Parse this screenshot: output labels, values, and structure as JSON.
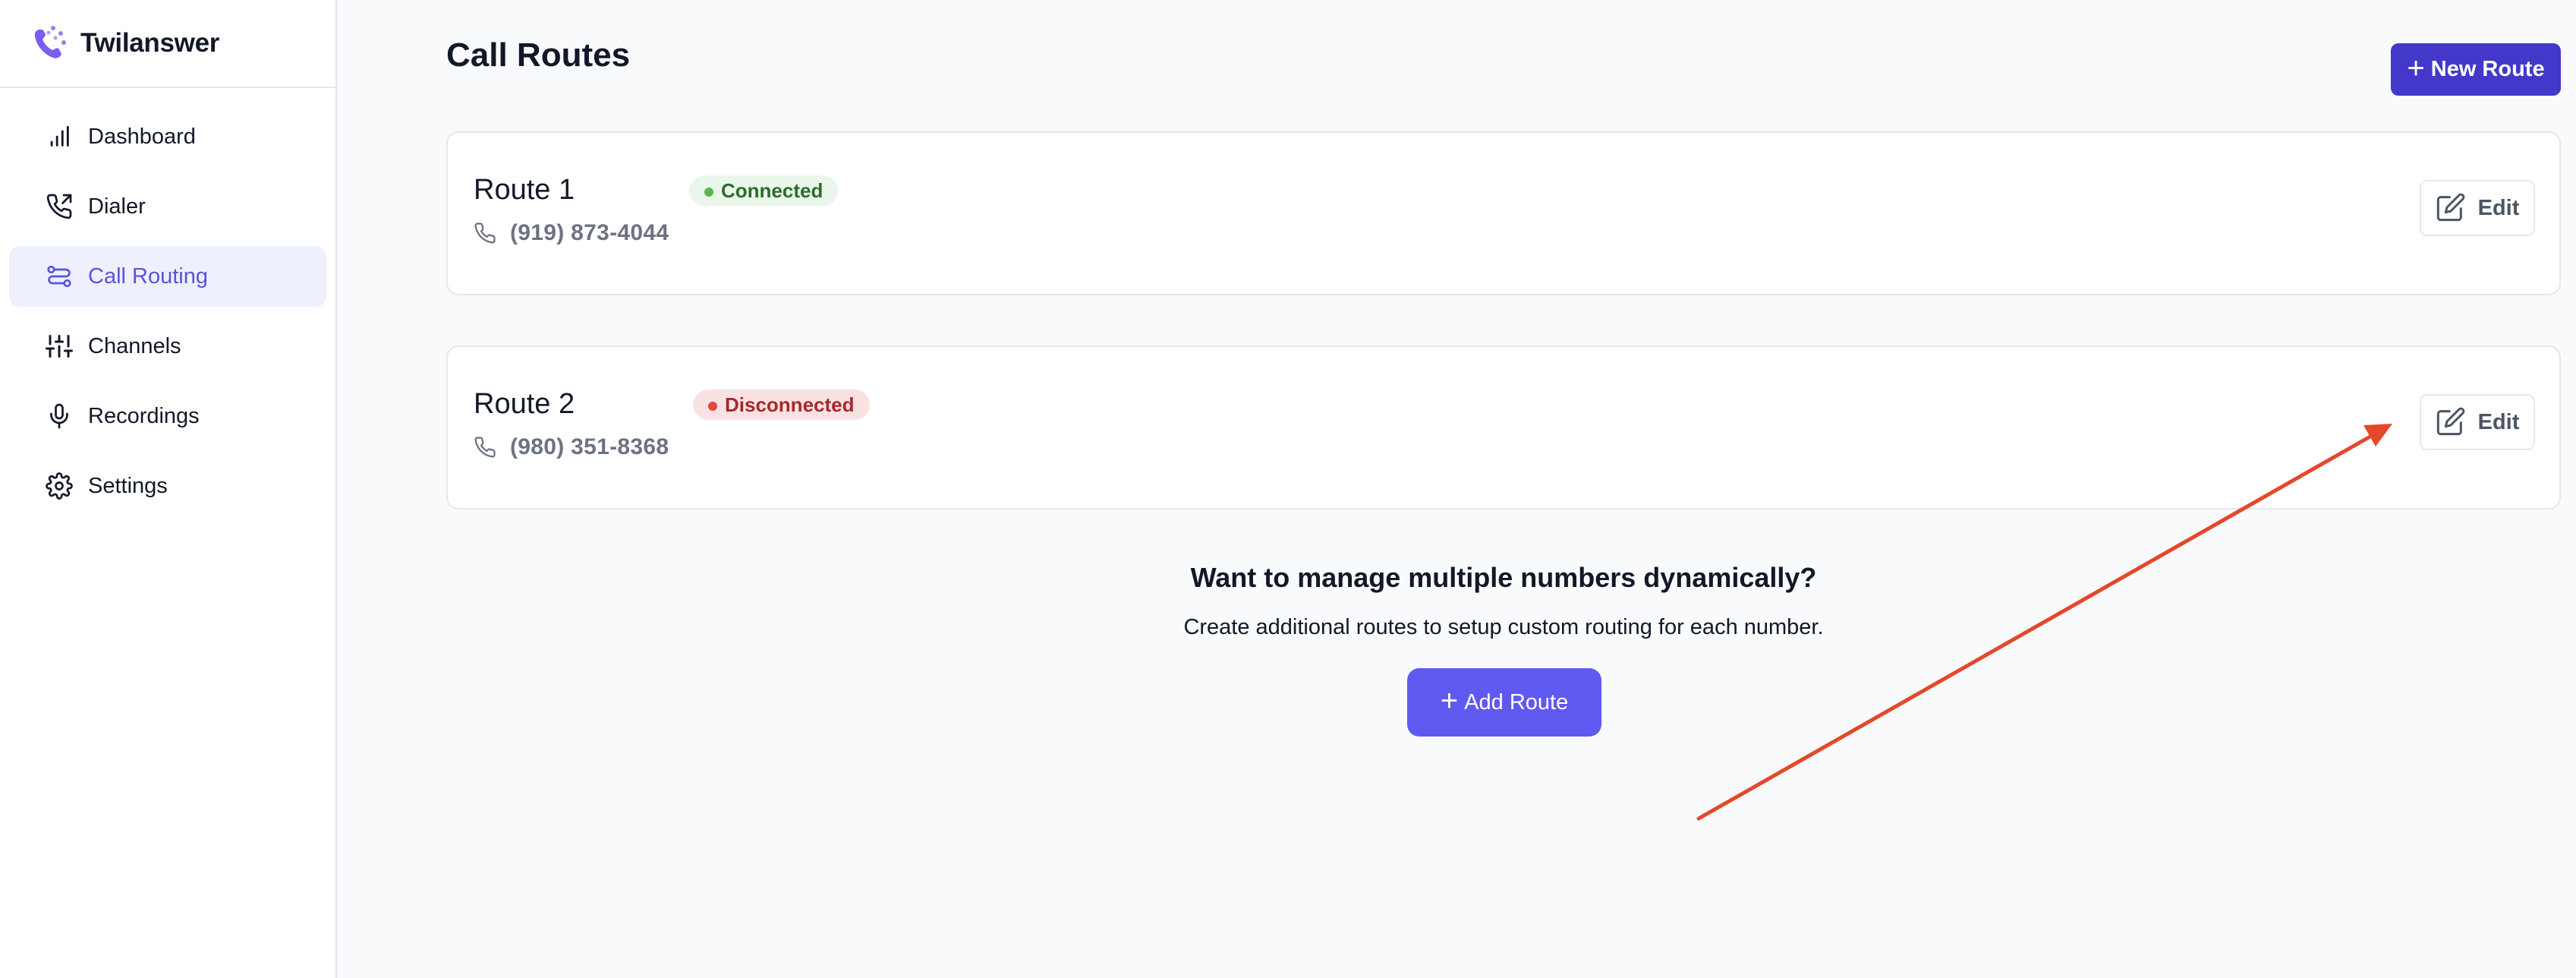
{
  "brand": {
    "name": "Twilanswer",
    "logo_icon": "phone-sparkle-icon"
  },
  "sidebar": {
    "items": [
      {
        "label": "Dashboard",
        "icon": "bar-chart-icon",
        "active": false
      },
      {
        "label": "Dialer",
        "icon": "phone-outgoing-icon",
        "active": false
      },
      {
        "label": "Call Routing",
        "icon": "route-icon",
        "active": true
      },
      {
        "label": "Channels",
        "icon": "sliders-icon",
        "active": false
      },
      {
        "label": "Recordings",
        "icon": "microphone-icon",
        "active": false
      },
      {
        "label": "Settings",
        "icon": "gear-icon",
        "active": false
      }
    ]
  },
  "header": {
    "title": "Call Routes",
    "new_route_label": "New Route"
  },
  "routes": [
    {
      "name": "Route 1",
      "status": "Connected",
      "phone": "(919) 873-4044",
      "edit_label": "Edit"
    },
    {
      "name": "Route 2",
      "status": "Disconnected",
      "phone": "(980) 351-8368",
      "edit_label": "Edit"
    }
  ],
  "cta": {
    "title": "Want to manage multiple numbers dynamically?",
    "subtitle": "Create additional routes to setup custom routing for each number.",
    "button_label": "Add Route"
  },
  "colors": {
    "accent": "#4338ca",
    "active_nav": "#5a54d8",
    "add_button": "#6059f0",
    "connected": "#56b94c",
    "disconnected": "#e74444",
    "annotation_arrow": "#e5472b"
  }
}
